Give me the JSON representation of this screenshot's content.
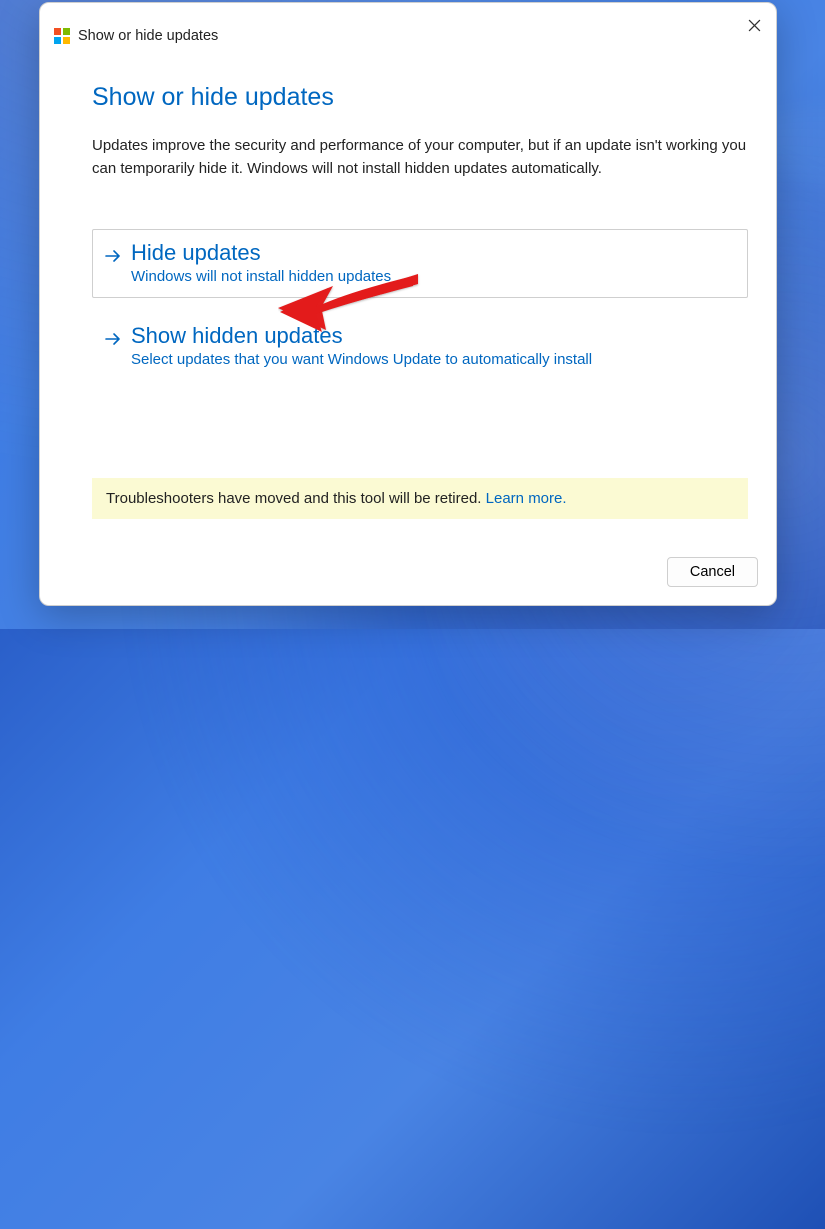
{
  "titlebar": {
    "app_name": "Show or hide updates"
  },
  "content": {
    "heading": "Show or hide updates",
    "intro": "Updates improve the security and performance of your computer, but if an update isn't working you can temporarily hide it. Windows will not install hidden updates automatically."
  },
  "options": {
    "hide": {
      "title": "Hide updates",
      "desc": "Windows will not install hidden updates"
    },
    "show": {
      "title": "Show hidden updates",
      "desc": "Select updates that you want Windows Update to automatically install"
    }
  },
  "notice": {
    "text": "Troubleshooters have moved and this tool will be retired. ",
    "link": "Learn more."
  },
  "buttons": {
    "cancel": "Cancel"
  },
  "colors": {
    "accent": "#0067c0",
    "notice_bg": "#fbfad3"
  }
}
